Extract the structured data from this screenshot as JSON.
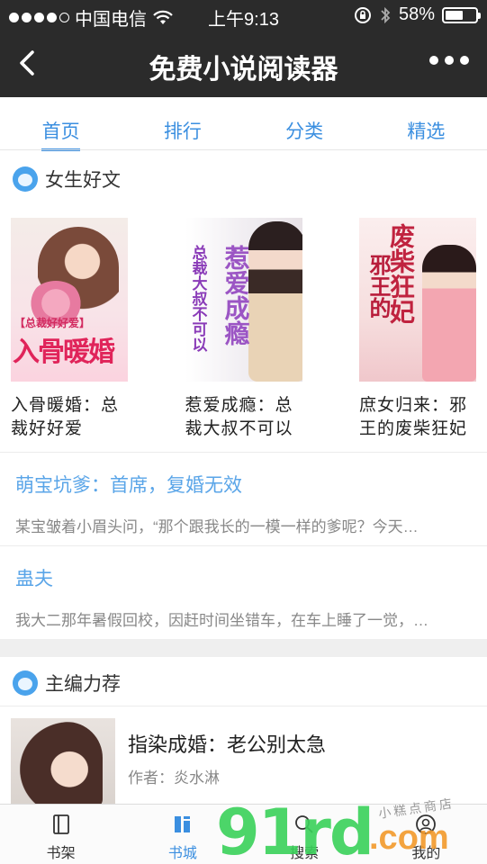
{
  "status_bar": {
    "carrier": "中国电信",
    "time": "上午9:13",
    "battery_percent": "58%",
    "battery_level": 0.58
  },
  "nav": {
    "title": "免费小说阅读器"
  },
  "tabs": [
    {
      "label": "首页",
      "active": true
    },
    {
      "label": "排行",
      "active": false
    },
    {
      "label": "分类",
      "active": false
    },
    {
      "label": "精选",
      "active": false
    }
  ],
  "section_female": {
    "title": "女生好文",
    "books": [
      {
        "name": "入骨暖婚：总裁好好爱",
        "cover_text": "入骨暖婚",
        "cover_sub": "【总裁好好爱】"
      },
      {
        "name": "惹爱成瘾：总裁大叔不可以",
        "cover_text": "惹爱成瘾",
        "cover_sub": "总裁大叔不可以"
      },
      {
        "name": "庶女归来：邪王的废柴狂妃",
        "cover_text": "废柴狂妃",
        "cover_sub": "邪王的"
      }
    ],
    "list": [
      {
        "title": "萌宝坑爹：首席，复婚无效",
        "desc": "某宝皱着小眉头问，“那个跟我长的一模一样的爹呢？今天…"
      },
      {
        "title": "蛊夫",
        "desc": "我大二那年暑假回校，因赶时间坐错车，在车上睡了一觉，…"
      }
    ]
  },
  "section_editor": {
    "title": "主编力荐",
    "book": {
      "title": "指染成婚：老公别太急",
      "author": "作者：炎水淋"
    }
  },
  "tabbar": [
    {
      "label": "书架",
      "icon": "book-icon",
      "active": false
    },
    {
      "label": "书城",
      "icon": "store-icon",
      "active": true
    },
    {
      "label": "搜索",
      "icon": "search-icon",
      "active": false
    },
    {
      "label": "我的",
      "icon": "user-icon",
      "active": false
    }
  ],
  "watermark": {
    "text": "91rd",
    "suffix": ".com",
    "shop": "小糕点商店"
  },
  "colors": {
    "accent": "#3b8fe0",
    "navbar": "#2b2b2b",
    "link": "#5aa5e8"
  }
}
